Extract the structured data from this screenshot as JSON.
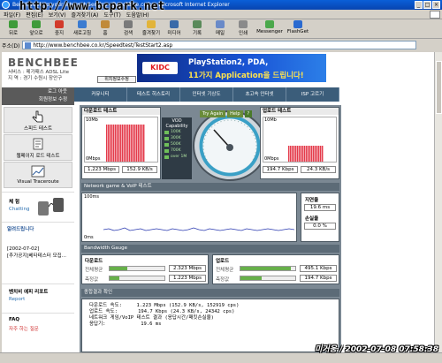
{
  "window": {
    "title": "Benchmark to your Internet Service - Benchbee.co.kr - Microsoft Internet Explorer",
    "watermark": "http://www.bcpark.net",
    "min": "_",
    "max": "□",
    "close": "×"
  },
  "menu": [
    "파일(F)",
    "편집(E)",
    "보기(V)",
    "즐겨찾기(A)",
    "도구(T)",
    "도움말(H)"
  ],
  "toolbar": [
    "뒤로",
    "앞으로",
    "중지",
    "새로고침",
    "홈",
    "검색",
    "즐겨찾기",
    "미디어",
    "기록",
    "메일",
    "인쇄",
    "Messenger",
    "FlashGet"
  ],
  "address": {
    "label": "주소(D)",
    "url": "http://www.benchbee.co.kr/Speedtest/TestStart2.asp"
  },
  "site": {
    "logo": "BENCHBEE",
    "service_label": "서비스",
    "service_value": "메가패스 ADSL Lite",
    "region_label": "지 역",
    "region_value": "경기 수원시 장안구",
    "info_button": "위치정보수정"
  },
  "banner": {
    "brand": "KIDC",
    "line1": "PlayStation2, PDA,",
    "line2": "11가지 Application을 드립니다!"
  },
  "left_nav": {
    "login": "로그 아웃",
    "edit": "회원정보 수정",
    "items": [
      "스피드 테스트",
      "웹페이지 로드 테스트",
      "Visual Traceroute"
    ],
    "experience": "체 험",
    "chatting": "Chatting",
    "notice_title": "알려드립니다",
    "notice1": "[2002-07-02]",
    "notice2": "[추가공지]베타테스터 모집...",
    "report_title": "벤치비 에피 리포트",
    "report_sub": "Report",
    "faq_title": "FAQ",
    "faq_sub": "자주 하는 질문"
  },
  "nav_tabs": [
    "커뮤니티",
    "테스트 히스토리",
    "인터넷 기상도",
    "초고속 인터넷",
    "ISP 고르기"
  ],
  "download": {
    "title": "다운로드 테스트",
    "max": "10Mb",
    "min": "0Mbps",
    "mbps": "1,223 Mbps",
    "kbs": "152.9 KB/s"
  },
  "upload": {
    "title": "업로드 테스트",
    "max": "10Mb",
    "min": "0Mbps",
    "kbps": "194.7 Kbps",
    "kbs": "24.3 KB/s"
  },
  "gauge": {
    "try_again": "Try Again",
    "help": "Help",
    "question": "?",
    "vod_title": "VOD Capability",
    "vod": [
      "100K",
      "300K",
      "500K",
      "700K",
      "over 1M"
    ]
  },
  "latency": {
    "section": "Network game & VoIP 테스트",
    "y_top": "100ms",
    "y_bottom": "0ms",
    "delay_label": "지연율",
    "delay_value": "19.6 ms",
    "loss_label": "손실율",
    "loss_value": "0.0 %"
  },
  "bandwidth": {
    "section": "Bandwidth Gauge",
    "down_title": "다운로드",
    "up_title": "업로드",
    "down_rows": [
      {
        "label": "전체평균",
        "value": "2.323 Mbps",
        "fill": 0.32
      },
      {
        "label": "측정값",
        "value": "1.223 Mbps",
        "fill": 0.17
      }
    ],
    "up_rows": [
      {
        "label": "전체평균",
        "value": "495.1 Kbps",
        "fill": 0.92
      },
      {
        "label": "측정값",
        "value": "194.7 Kbps",
        "fill": 0.38
      }
    ]
  },
  "result": {
    "section": "종합결과 확인",
    "lines": [
      "다운로드 속도:     1.223 Mbps (152.9 KB/s, 152919 cps)",
      "업로드 속도:       194.7 Kbps (24.3 KB/s, 24342 cps)",
      "",
      "네트워크 게임/VoIP 테스트 결과 (응답시간/패킷손실율)",
      "",
      "응답기:            19.6 ms"
    ]
  },
  "footer_stamp": "미거웅 / 2002-07-08 07:58:38"
}
